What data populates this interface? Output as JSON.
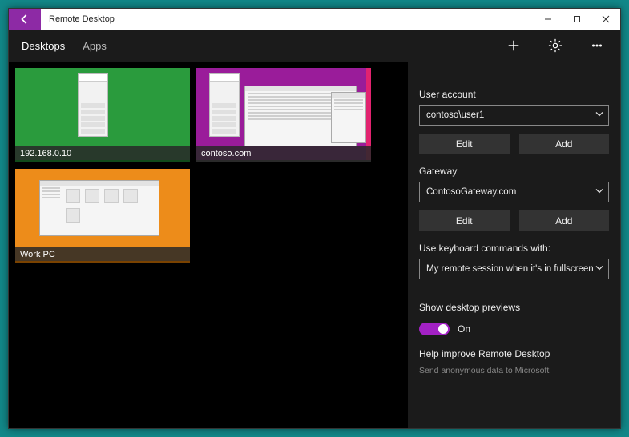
{
  "titlebar": {
    "title": "Remote Desktop"
  },
  "tabs": {
    "desktops": "Desktops",
    "apps": "Apps"
  },
  "connections": [
    {
      "label": "192.168.0.10"
    },
    {
      "label": "contoso.com"
    },
    {
      "label": "Work PC"
    }
  ],
  "settings": {
    "user_account": {
      "label": "User account",
      "value": "contoso\\user1",
      "edit": "Edit",
      "add": "Add"
    },
    "gateway": {
      "label": "Gateway",
      "value": "ContosoGateway.com",
      "edit": "Edit",
      "add": "Add"
    },
    "keyboard": {
      "label": "Use keyboard commands with:",
      "value": "My remote session when it's in fullscreen"
    },
    "previews": {
      "label": "Show desktop previews",
      "state": "On"
    },
    "help": {
      "label": "Help improve Remote Desktop",
      "sub": "Send anonymous data to Microsoft"
    }
  }
}
